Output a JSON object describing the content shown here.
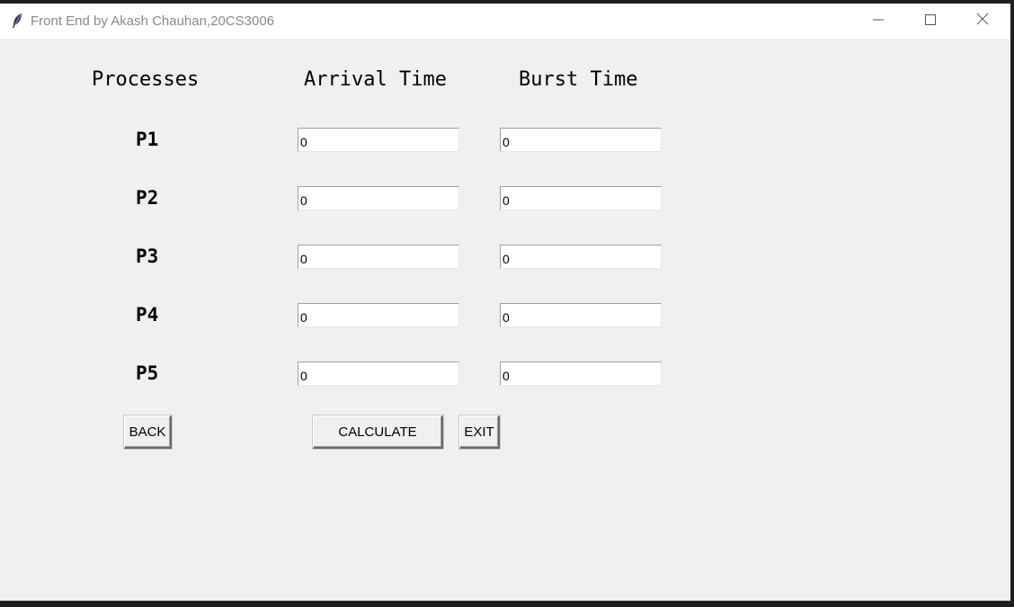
{
  "window": {
    "title": "Front End by Akash Chauhan,20CS3006",
    "icon": "feather-icon",
    "controls": [
      "minimize-icon",
      "maximize-icon",
      "close-icon"
    ]
  },
  "table": {
    "headers": {
      "process": "Processes",
      "arrival": "Arrival Time",
      "burst": "Burst Time"
    },
    "rows": [
      {
        "process": "P1",
        "arrival": "0",
        "burst": "0"
      },
      {
        "process": "P2",
        "arrival": "0",
        "burst": "0"
      },
      {
        "process": "P3",
        "arrival": "0",
        "burst": "0"
      },
      {
        "process": "P4",
        "arrival": "0",
        "burst": "0"
      },
      {
        "process": "P5",
        "arrival": "0",
        "burst": "0"
      }
    ]
  },
  "buttons": {
    "back": "BACK",
    "calculate": "CALCULATE",
    "exit": "EXIT"
  }
}
